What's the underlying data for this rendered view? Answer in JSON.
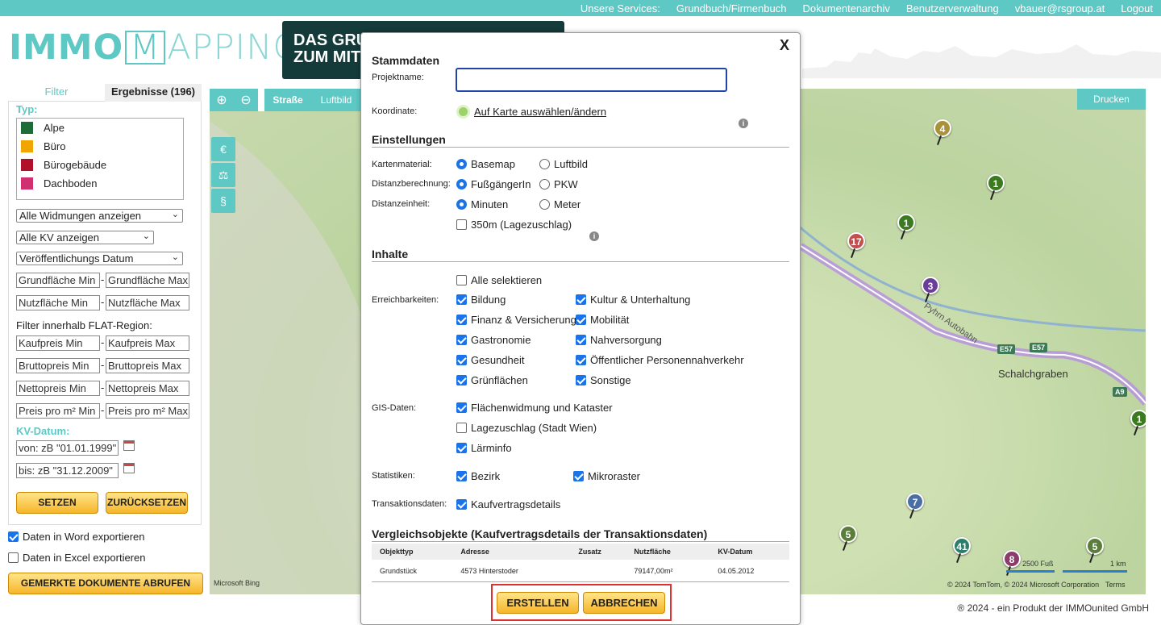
{
  "topbar": {
    "items": [
      "Unsere Services:",
      "Grundbuch/Firmenbuch",
      "Dokumentenarchiv",
      "Benutzerverwaltung",
      "vbauer@rsgroup.at",
      "Logout"
    ]
  },
  "logo": {
    "part1": "IMMO",
    "part2": "M",
    "part3": "APPING"
  },
  "banner": {
    "line1": "DAS GRU",
    "line2": "ZUM MIT"
  },
  "sidebar": {
    "tab_filter": "Filter",
    "tab_results": "Ergebnisse (196)",
    "typ_label": "Typ:",
    "types": [
      {
        "label": "Alpe",
        "color": "#1e6b3a"
      },
      {
        "label": "Büro",
        "color": "#f0a500"
      },
      {
        "label": "Bürogebäude",
        "color": "#b0102a"
      },
      {
        "label": "Dachboden",
        "color": "#d0306e"
      }
    ],
    "widmungen": "Alle Widmungen anzeigen",
    "kv": "Alle KV anzeigen",
    "datum": "Veröffentlichungs Datum",
    "grund_min": "Grundfläche Min",
    "grund_max": "Grundfläche Max",
    "nutz_min": "Nutzfläche Min",
    "nutz_max": "Nutzfläche Max",
    "flat_label": "Filter innerhalb FLAT-Region:",
    "kauf_min": "Kaufpreis Min",
    "kauf_max": "Kaufpreis Max",
    "brutto_min": "Bruttopreis Min",
    "brutto_max": "Bruttopreis Max",
    "netto_min": "Nettopreis Min",
    "netto_max": "Nettopreis Max",
    "qm_min": "Preis pro m² Min",
    "qm_max": "Preis pro m² Max",
    "kv_datum_label": "KV-Datum:",
    "von": "von: zB \"01.01.1999\"",
    "bis": "bis: zB \"31.12.2009\"",
    "setzen": "SETZEN",
    "zuruecksetzen": "ZURÜCKSETZEN",
    "export_word": "Daten in Word exportieren",
    "export_excel": "Daten in Excel exportieren",
    "gemerkte": "GEMERKTE DOKUMENTE ABRUFEN"
  },
  "map": {
    "strasse": "Straße",
    "luftbild": "Luftbild",
    "drucken": "Drucken",
    "place": "Schalchgraben",
    "road": "Pyhrn Autobahn",
    "e57": "E57",
    "e57b": "E57",
    "a9": "A9",
    "bing": "Microsoft Bing",
    "scale_ft": "2500 Fuß",
    "scale_km": "1 km",
    "copyright": "© 2024 TomTom, © 2024 Microsoft Corporation",
    "terms": "Terms",
    "pins": [
      "4",
      "1",
      "1",
      "17",
      "3",
      "1",
      "7",
      "5",
      "41",
      "8",
      "5"
    ]
  },
  "modal": {
    "close": "X",
    "stammdaten": "Stammdaten",
    "projektname": "Projektname:",
    "koordinate": "Koordinate:",
    "karte_link": "Auf Karte auswählen/ändern",
    "einstellungen": "Einstellungen",
    "kartenmaterial": "Kartenmaterial:",
    "basemap": "Basemap",
    "luftbild": "Luftbild",
    "distanzberechnung": "Distanzberechnung:",
    "fuss": "FußgängerIn",
    "pkw": "PKW",
    "distanzeinheit": "Distanzeinheit:",
    "minuten": "Minuten",
    "meter": "Meter",
    "lagezuschlag350": "350m (Lagezuschlag)",
    "inhalte": "Inhalte",
    "alle": "Alle selektieren",
    "erreichbarkeiten": "Erreichbarkeiten:",
    "bildung": "Bildung",
    "kultur": "Kultur & Unterhaltung",
    "finanz": "Finanz & Versicherung",
    "mobilitaet": "Mobilität",
    "gastro": "Gastronomie",
    "nahversorgung": "Nahversorgung",
    "gesundheit": "Gesundheit",
    "oeffentlich": "Öffentlicher Personennahverkehr",
    "gruen": "Grünflächen",
    "sonstige": "Sonstige",
    "gis": "GIS-Daten:",
    "flaechen": "Flächenwidmung und Kataster",
    "lagezuschlag": "Lagezuschlag (Stadt Wien)",
    "laerm": "Lärminfo",
    "statistiken": "Statistiken:",
    "bezirk": "Bezirk",
    "mikroraster": "Mikroraster",
    "transaktionsdaten": "Transaktionsdaten:",
    "kaufvertrag": "Kaufvertragsdetails",
    "vergleich": "Vergleichsobjekte (Kaufvertragsdetails der Transaktionsdaten)",
    "table_headers": [
      "Objekttyp",
      "Adresse",
      "Zusatz",
      "Nutzfläche",
      "KV-Datum"
    ],
    "table_row": [
      "Grundstück",
      "4573 Hinterstoder",
      "",
      "79147,00m²",
      "04.05.2012"
    ],
    "erstellen": "ERSTELLEN",
    "abbrechen": "ABBRECHEN"
  },
  "footer": "® 2024 - ein Produkt der IMMOunited GmbH"
}
